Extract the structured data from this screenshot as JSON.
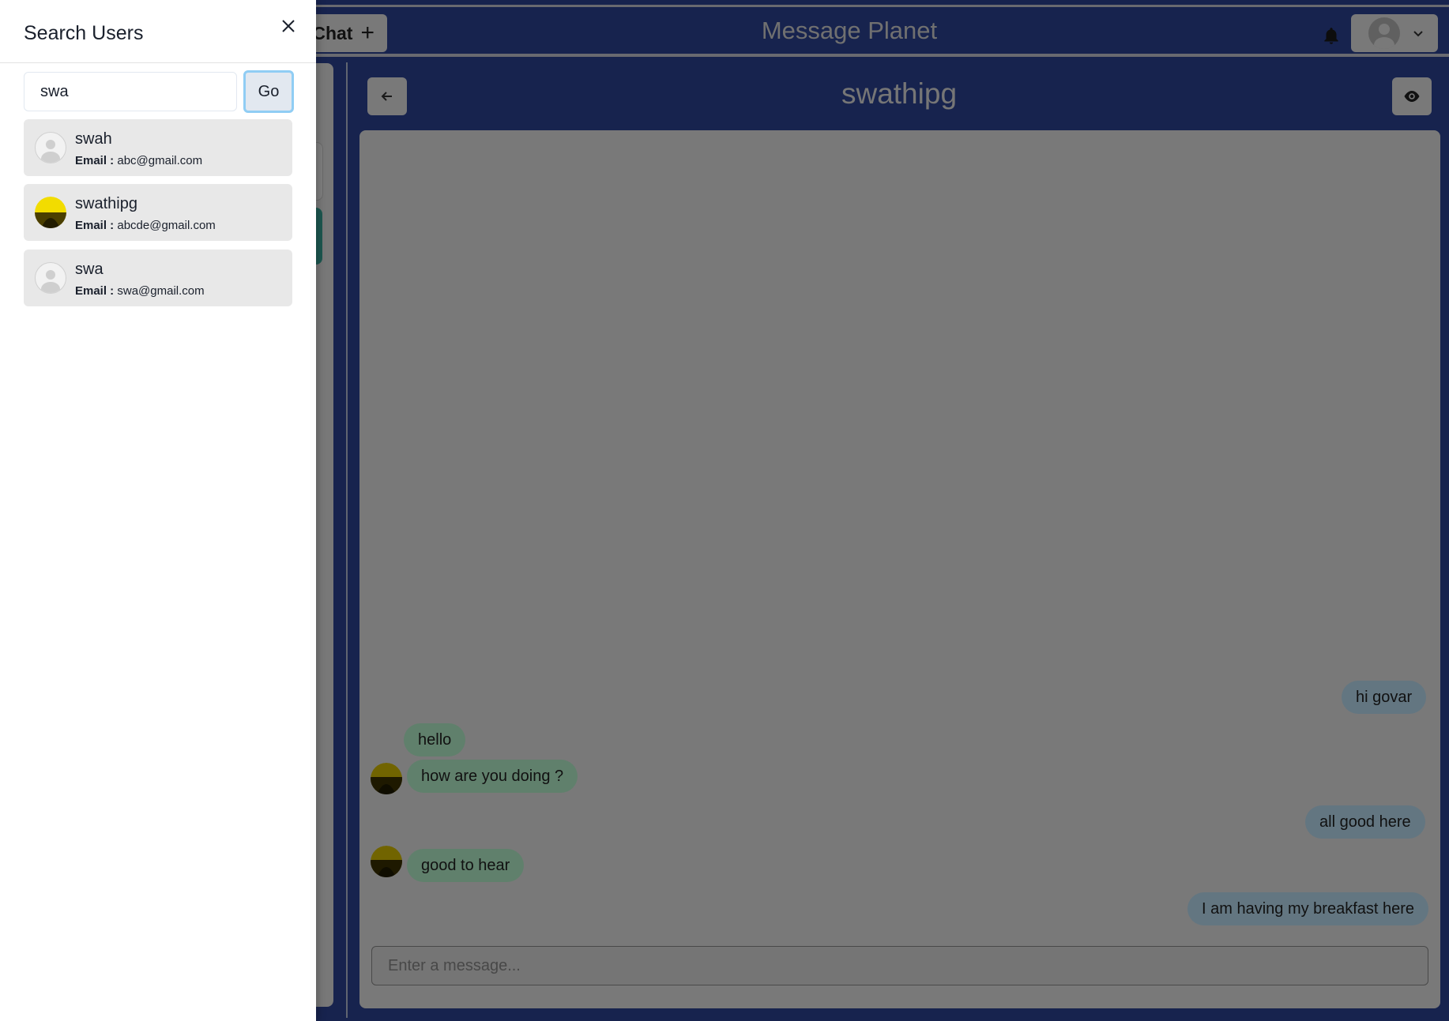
{
  "header": {
    "new_chat_label": "New Group Chat",
    "new_chat_visible": "Chat",
    "app_title": "Message Planet",
    "notification_icon": "bell-icon",
    "profile_icon": "avatar-icon"
  },
  "chat": {
    "title": "swathipg",
    "back_icon": "arrow-left-icon",
    "view_icon": "eye-icon",
    "input_placeholder": "Enter a message...",
    "messages": [
      {
        "text": "hi govar",
        "sender": "me"
      },
      {
        "text": "hello",
        "sender": "swathipg"
      },
      {
        "text": "how are you doing ?",
        "sender": "swathipg"
      },
      {
        "text": "all good here",
        "sender": "me"
      },
      {
        "text": "good to hear",
        "sender": "swathipg"
      },
      {
        "text": "I am having my breakfast here",
        "sender": "me"
      }
    ]
  },
  "drawer": {
    "title": "Search Users",
    "close_icon": "close-icon",
    "search_value": "swa",
    "go_label": "Go",
    "email_label": "Email :",
    "results": [
      {
        "name": "swah",
        "email": "abc@gmail.com",
        "avatar": "default"
      },
      {
        "name": "swathipg",
        "email": "abcde@gmail.com",
        "avatar": "photo"
      },
      {
        "name": "swa",
        "email": "swa@gmail.com",
        "avatar": "default"
      }
    ]
  },
  "colors": {
    "brand_blue": "#2d4396",
    "my_bubble": "#bee3f8",
    "their_bubble": "#b9f5d0",
    "active_chat": "#37a89a",
    "go_focus_ring": "#90cdf4"
  }
}
